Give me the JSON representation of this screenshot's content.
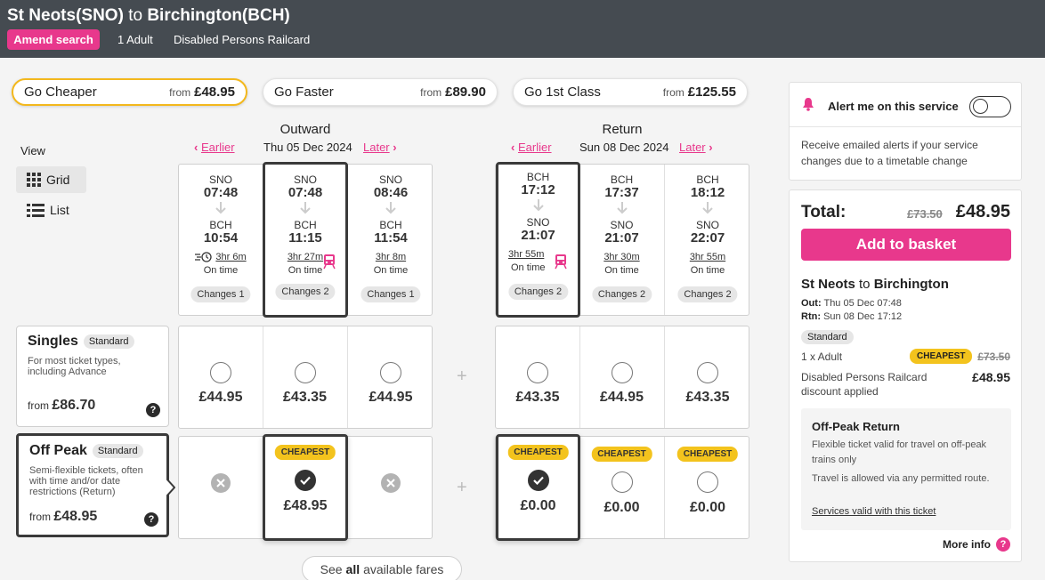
{
  "header": {
    "origin": "St Neots(SNO)",
    "connector": "to",
    "destination": "Birchington(BCH)",
    "amend_label": "Amend search",
    "passengers": "1 Adult",
    "railcard": "Disabled Persons Railcard"
  },
  "tabs": [
    {
      "label": "Go Cheaper",
      "from": "from",
      "price": "£48.95"
    },
    {
      "label": "Go Faster",
      "from": "from",
      "price": "£89.90"
    },
    {
      "label": "Go 1st Class",
      "from": "from",
      "price": "£125.55"
    }
  ],
  "view": {
    "label": "View",
    "grid": "Grid",
    "list": "List"
  },
  "outward": {
    "title": "Outward",
    "earlier": "Earlier",
    "date": "Thu 05 Dec 2024",
    "later": "Later",
    "journeys": [
      {
        "from": "SNO",
        "dep": "07:48",
        "to": "BCH",
        "arr": "10:54",
        "duration": "3hr 6m",
        "status": "On time",
        "changes": "Changes 1"
      },
      {
        "from": "SNO",
        "dep": "07:48",
        "to": "BCH",
        "arr": "11:15",
        "duration": "3hr 27m",
        "status": "On time",
        "changes": "Changes 2"
      },
      {
        "from": "SNO",
        "dep": "08:46",
        "to": "BCH",
        "arr": "11:54",
        "duration": "3hr 8m",
        "status": "On time",
        "changes": "Changes 1"
      }
    ]
  },
  "return": {
    "title": "Return",
    "earlier": "Earlier",
    "date": "Sun 08 Dec 2024",
    "later": "Later",
    "journeys": [
      {
        "from": "BCH",
        "dep": "17:12",
        "to": "SNO",
        "arr": "21:07",
        "duration": "3hr 55m",
        "status": "On time",
        "changes": "Changes 2"
      },
      {
        "from": "BCH",
        "dep": "17:37",
        "to": "SNO",
        "arr": "21:07",
        "duration": "3hr 30m",
        "status": "On time",
        "changes": "Changes 2"
      },
      {
        "from": "BCH",
        "dep": "18:12",
        "to": "SNO",
        "arr": "22:07",
        "duration": "3hr 55m",
        "status": "On time",
        "changes": "Changes 2"
      }
    ]
  },
  "fares": {
    "singles": {
      "name": "Singles",
      "badge": "Standard",
      "desc": "For most ticket types, including Advance",
      "from": "from",
      "price": "£86.70",
      "help": "?",
      "outward": [
        "£44.95",
        "£43.35",
        "£44.95"
      ],
      "return": [
        "£43.35",
        "£44.95",
        "£43.35"
      ]
    },
    "offpeak": {
      "name": "Off Peak",
      "badge": "Standard",
      "desc": "Semi-flexible tickets, often with time and/or date restrictions (Return)",
      "from": "from",
      "price": "£48.95",
      "help": "?",
      "cheapest": "CHEAPEST",
      "outward_price": "£48.95",
      "return": [
        "£0.00",
        "£0.00",
        "£0.00"
      ]
    },
    "plus": "+"
  },
  "see_all": {
    "prefix": "See",
    "bold": "all",
    "suffix": "available fares"
  },
  "alert": {
    "title": "Alert me on this service",
    "desc": "Receive emailed alerts if your service changes due to a timetable change"
  },
  "basket": {
    "total_label": "Total:",
    "total_old": "£73.50",
    "total_new": "£48.95",
    "add_label": "Add to basket",
    "journey_origin": "St Neots",
    "journey_connector": "to",
    "journey_dest": "Birchington",
    "out_label": "Out:",
    "out_value": "Thu 05 Dec 07:48",
    "rtn_label": "Rtn:",
    "rtn_value": "Sun 08 Dec 17:12",
    "class": "Standard",
    "adult": "1 x Adult",
    "cheapest": "CHEAPEST",
    "adult_old": "£73.50",
    "discount_text": "Disabled Persons Railcard discount applied",
    "discount_price": "£48.95",
    "ticket_title": "Off-Peak Return",
    "ticket_desc1": "Flexible ticket valid for travel on off-peak trains only",
    "ticket_desc2": "Travel is allowed via any permitted route.",
    "ticket_link": "Services valid with this ticket",
    "more_info": "More info",
    "more_q": "?"
  },
  "colors": {
    "header_bg": "#454b51",
    "brand_pink": "#e8388c",
    "cheapest_yellow": "#f3c31d",
    "active_tab_border": "#f3b81d"
  }
}
